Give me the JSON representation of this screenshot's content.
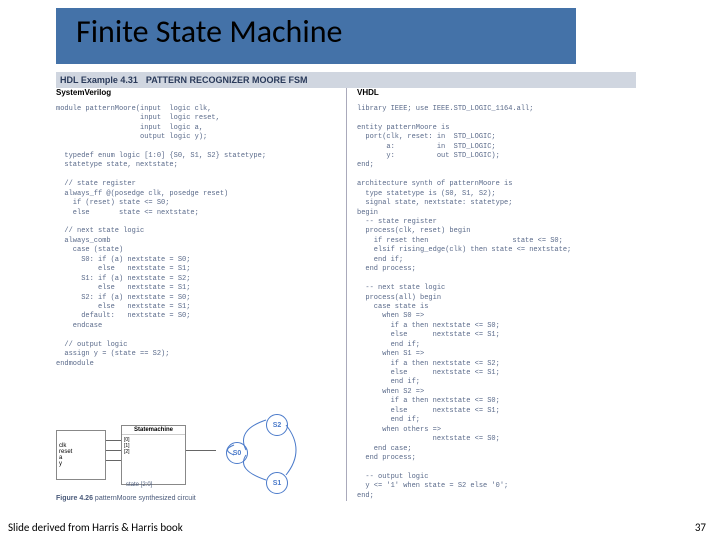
{
  "title": "Finite State Machine",
  "hdl": {
    "prefix": "HDL Example 4.31",
    "name": "PATTERN RECOGNIZER MOORE FSM"
  },
  "columns": {
    "left_head": "SystemVerilog",
    "right_head": "VHDL"
  },
  "code": {
    "systemverilog": "module patternMoore(input  logic clk,\n                    input  logic reset,\n                    input  logic a,\n                    output logic y);\n\n  typedef enum logic [1:0] {S0, S1, S2} statetype;\n  statetype state, nextstate;\n\n  // state register\n  always_ff @(posedge clk, posedge reset)\n    if (reset) state <= S0;\n    else       state <= nextstate;\n\n  // next state logic\n  always_comb\n    case (state)\n      S0: if (a) nextstate = S0;\n          else   nextstate = S1;\n      S1: if (a) nextstate = S2;\n          else   nextstate = S1;\n      S2: if (a) nextstate = S0;\n          else   nextstate = S1;\n      default:   nextstate = S0;\n    endcase\n\n  // output logic\n  assign y = (state == S2);\nendmodule",
    "vhdl": "library IEEE; use IEEE.STD_LOGIC_1164.all;\n\nentity patternMoore is\n  port(clk, reset: in  STD_LOGIC;\n       a:          in  STD_LOGIC;\n       y:          out STD_LOGIC);\nend;\n\narchitecture synth of patternMoore is\n  type statetype is (S0, S1, S2);\n  signal state, nextstate: statetype;\nbegin\n  -- state register\n  process(clk, reset) begin\n    if reset then                    state <= S0;\n    elsif rising_edge(clk) then state <= nextstate;\n    end if;\n  end process;\n\n  -- next state logic\n  process(all) begin\n    case state is\n      when S0 =>\n        if a then nextstate <= S0;\n        else      nextstate <= S1;\n        end if;\n      when S1 =>\n        if a then nextstate <= S2;\n        else      nextstate <= S1;\n        end if;\n      when S2 =>\n        if a then nextstate <= S0;\n        else      nextstate <= S1;\n        end if;\n      when others =>\n                  nextstate <= S0;\n    end case;\n  end process;\n\n  -- output logic\n  y <= '1' when state = S2 else '0';\nend;"
  },
  "diagram": {
    "logic_ports": "clk\nreset\na\ny",
    "sm_title": "Statemachine",
    "sm_ports_left": "[0]\n[1]\n[2]",
    "state_bus": "state [2:0]",
    "states": {
      "s0": "S0",
      "s1": "S1",
      "s2": "S2"
    }
  },
  "figure": {
    "num": "Figure 4.26",
    "text": "patternMoore synthesized circuit"
  },
  "footer": {
    "left": "Slide derived from Harris & Harris book",
    "right": "37"
  }
}
